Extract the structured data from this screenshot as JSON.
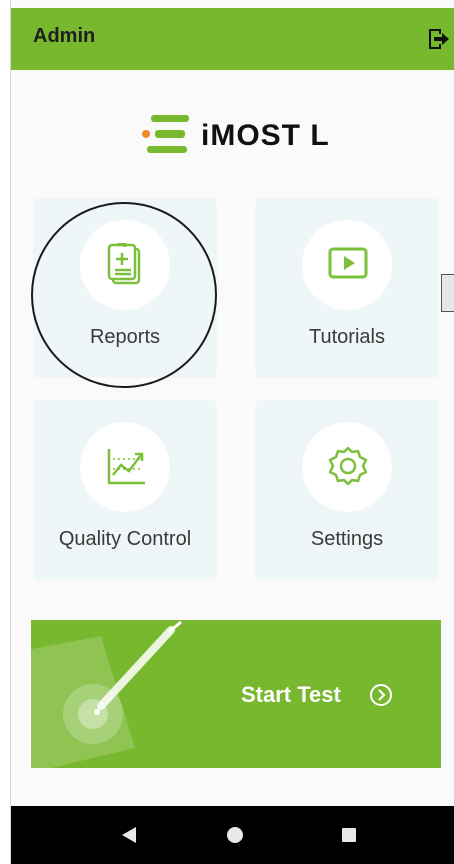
{
  "header": {
    "title": "Admin",
    "logout_icon": "logout-icon"
  },
  "logo": {
    "text": "iMOST L",
    "mark_color": "#77b82e",
    "accent_color": "#f08a24"
  },
  "tiles": [
    {
      "label": "Reports",
      "icon": "report-clipboard-icon"
    },
    {
      "label": "Tutorials",
      "icon": "play-video-icon"
    },
    {
      "label": "Quality Control",
      "icon": "trend-chart-icon"
    },
    {
      "label": "Settings",
      "icon": "gear-icon"
    }
  ],
  "start": {
    "label": "Start Test",
    "icon": "chevron-circle-right-icon"
  },
  "navbar": {
    "back_icon": "back-triangle-icon",
    "home_icon": "home-circle-icon",
    "recents_icon": "recents-square-icon"
  },
  "colors": {
    "brand": "#77b82e",
    "tile_bg": "#eef6f8",
    "icon_green": "#7bbf3a"
  }
}
